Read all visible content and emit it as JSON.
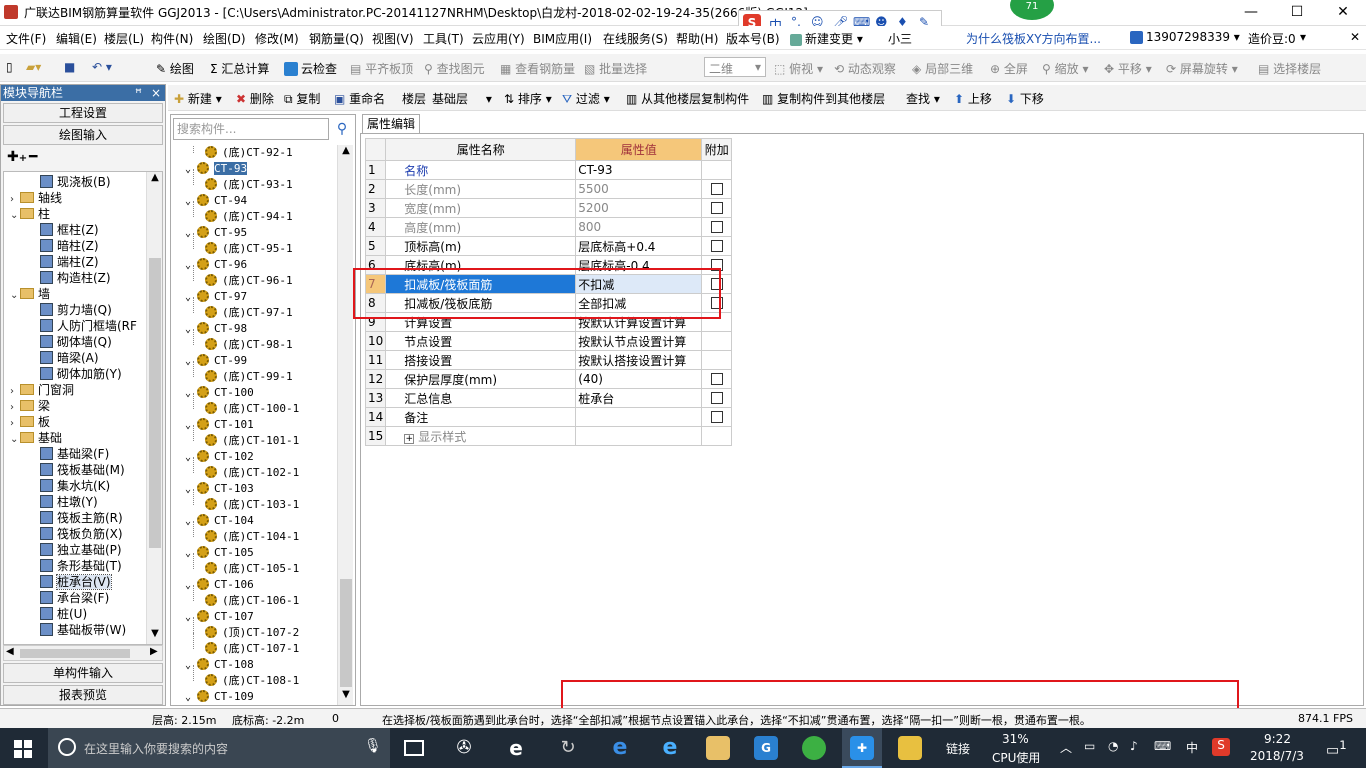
{
  "window": {
    "title": "广联达BIM钢筋算量软件 GGJ2013 - [C:\\Users\\Administrator.PC-20141127NRHM\\Desktop\\白龙村-2018-02-02-19-24-35(2666版).GGJ12]",
    "minimize": "—",
    "maximize": "☐",
    "close": "✕"
  },
  "overlay": {
    "badge_number": "71",
    "ime_text": "中",
    "hint_link": "为什么筏板XY方向布置...",
    "phone": "13907298339",
    "price_label": "造价豆:0",
    "new_change": "新建变更",
    "small_label": "小三",
    "version_label": "版本号(B)"
  },
  "menu": [
    "文件(F)",
    "编辑(E)",
    "楼层(L)",
    "构件(N)",
    "绘图(D)",
    "修改(M)",
    "钢筋量(Q)",
    "视图(V)",
    "工具(T)",
    "云应用(Y)",
    "BIM应用(I)",
    "在线服务(S)",
    "帮助(H)"
  ],
  "toolbar1": {
    "draw": "绘图",
    "sum": "汇总计算",
    "cloud_check": "云检查",
    "flat_top": "平齐板顶",
    "find_elem": "查找图元",
    "view_rebar": "查看钢筋量",
    "batch_select": "批量选择",
    "view_mode": "二维",
    "top_view": "俯视",
    "dyn_view": "动态观察",
    "local_3d": "局部三维",
    "fullscreen": "全屏",
    "zoom": "缩放",
    "pan": "平移",
    "rotate": "屏幕旋转",
    "select_floor": "选择楼层"
  },
  "toolbar2": {
    "new": "新建",
    "delete": "删除",
    "copy": "复制",
    "rename": "重命名",
    "floor_label": "楼层",
    "floor_value": "基础层",
    "sort": "排序",
    "filter": "过滤",
    "copy_from": "从其他楼层复制构件",
    "copy_to": "复制构件到其他楼层",
    "find": "查找",
    "move_up": "上移",
    "move_down": "下移"
  },
  "nav": {
    "header": "模块导航栏",
    "pin": "ꟸ",
    "close": "×",
    "project_settings": "工程设置",
    "drawing_input": "绘图输入",
    "single_input": "单构件输入",
    "report_preview": "报表预览",
    "tree": [
      {
        "label": "现浇板(B)",
        "level": 2,
        "type": "comp"
      },
      {
        "label": "轴线",
        "level": 0,
        "type": "folder",
        "exp": "›"
      },
      {
        "label": "柱",
        "level": 0,
        "type": "folder",
        "exp": "⌄"
      },
      {
        "label": "框柱(Z)",
        "level": 2,
        "type": "comp"
      },
      {
        "label": "暗柱(Z)",
        "level": 2,
        "type": "comp"
      },
      {
        "label": "端柱(Z)",
        "level": 2,
        "type": "comp"
      },
      {
        "label": "构造柱(Z)",
        "level": 2,
        "type": "comp"
      },
      {
        "label": "墙",
        "level": 0,
        "type": "folder",
        "exp": "⌄"
      },
      {
        "label": "剪力墙(Q)",
        "level": 2,
        "type": "comp"
      },
      {
        "label": "人防门框墙(RF",
        "level": 2,
        "type": "comp"
      },
      {
        "label": "砌体墙(Q)",
        "level": 2,
        "type": "comp"
      },
      {
        "label": "暗梁(A)",
        "level": 2,
        "type": "comp"
      },
      {
        "label": "砌体加筋(Y)",
        "level": 2,
        "type": "comp"
      },
      {
        "label": "门窗洞",
        "level": 0,
        "type": "folder",
        "exp": "›"
      },
      {
        "label": "梁",
        "level": 0,
        "type": "folder",
        "exp": "›"
      },
      {
        "label": "板",
        "level": 0,
        "type": "folder",
        "exp": "›"
      },
      {
        "label": "基础",
        "level": 0,
        "type": "folder",
        "exp": "⌄"
      },
      {
        "label": "基础梁(F)",
        "level": 2,
        "type": "comp"
      },
      {
        "label": "筏板基础(M)",
        "level": 2,
        "type": "comp"
      },
      {
        "label": "集水坑(K)",
        "level": 2,
        "type": "comp"
      },
      {
        "label": "柱墩(Y)",
        "level": 2,
        "type": "comp"
      },
      {
        "label": "筏板主筋(R)",
        "level": 2,
        "type": "comp"
      },
      {
        "label": "筏板负筋(X)",
        "level": 2,
        "type": "comp"
      },
      {
        "label": "独立基础(P)",
        "level": 2,
        "type": "comp"
      },
      {
        "label": "条形基础(T)",
        "level": 2,
        "type": "comp"
      },
      {
        "label": "桩承台(V)",
        "level": 2,
        "type": "comp",
        "selected": true
      },
      {
        "label": "承台梁(F)",
        "level": 2,
        "type": "comp"
      },
      {
        "label": "桩(U)",
        "level": 2,
        "type": "comp"
      },
      {
        "label": "基础板带(W)",
        "level": 2,
        "type": "comp"
      }
    ]
  },
  "components": {
    "search_placeholder": "搜索构件...",
    "items": [
      {
        "label": "(底)CT-92-1",
        "child": true
      },
      {
        "label": "CT-93",
        "child": false,
        "selected": true
      },
      {
        "label": "(底)CT-93-1",
        "child": true
      },
      {
        "label": "CT-94",
        "child": false
      },
      {
        "label": "(底)CT-94-1",
        "child": true
      },
      {
        "label": "CT-95",
        "child": false
      },
      {
        "label": "(底)CT-95-1",
        "child": true
      },
      {
        "label": "CT-96",
        "child": false
      },
      {
        "label": "(底)CT-96-1",
        "child": true
      },
      {
        "label": "CT-97",
        "child": false
      },
      {
        "label": "(底)CT-97-1",
        "child": true
      },
      {
        "label": "CT-98",
        "child": false
      },
      {
        "label": "(底)CT-98-1",
        "child": true
      },
      {
        "label": "CT-99",
        "child": false
      },
      {
        "label": "(底)CT-99-1",
        "child": true
      },
      {
        "label": "CT-100",
        "child": false
      },
      {
        "label": "(底)CT-100-1",
        "child": true
      },
      {
        "label": "CT-101",
        "child": false
      },
      {
        "label": "(底)CT-101-1",
        "child": true
      },
      {
        "label": "CT-102",
        "child": false
      },
      {
        "label": "(底)CT-102-1",
        "child": true
      },
      {
        "label": "CT-103",
        "child": false
      },
      {
        "label": "(底)CT-103-1",
        "child": true
      },
      {
        "label": "CT-104",
        "child": false
      },
      {
        "label": "(底)CT-104-1",
        "child": true
      },
      {
        "label": "CT-105",
        "child": false
      },
      {
        "label": "(底)CT-105-1",
        "child": true
      },
      {
        "label": "CT-106",
        "child": false
      },
      {
        "label": "(底)CT-106-1",
        "child": true
      },
      {
        "label": "CT-107",
        "child": false
      },
      {
        "label": "(顶)CT-107-2",
        "child": true
      },
      {
        "label": "(底)CT-107-1",
        "child": true
      },
      {
        "label": "CT-108",
        "child": false
      },
      {
        "label": "(底)CT-108-1",
        "child": true
      },
      {
        "label": "CT-109",
        "child": false
      }
    ]
  },
  "properties": {
    "tab": "属性编辑",
    "col_name": "属性名称",
    "col_value": "属性值",
    "col_extra": "附加",
    "rows": [
      {
        "n": "1",
        "name": "名称",
        "value": "CT-93",
        "cb": false,
        "style": "blue"
      },
      {
        "n": "2",
        "name": "长度(mm)",
        "value": "5500",
        "cb": true,
        "style": "gray"
      },
      {
        "n": "3",
        "name": "宽度(mm)",
        "value": "5200",
        "cb": true,
        "style": "gray"
      },
      {
        "n": "4",
        "name": "高度(mm)",
        "value": "800",
        "cb": true,
        "style": "gray"
      },
      {
        "n": "5",
        "name": "顶标高(m)",
        "value": "层底标高+0.4",
        "cb": true,
        "style": ""
      },
      {
        "n": "6",
        "name": "底标高(m)",
        "value": "层底标高-0.4",
        "cb": true,
        "style": ""
      },
      {
        "n": "7",
        "name": "扣减板/筏板面筋",
        "value": "不扣减",
        "cb": true,
        "style": "",
        "hl": true
      },
      {
        "n": "8",
        "name": "扣减板/筏板底筋",
        "value": "全部扣减",
        "cb": true,
        "style": ""
      },
      {
        "n": "9",
        "name": "计算设置",
        "value": "按默认计算设置计算",
        "cb": false,
        "style": ""
      },
      {
        "n": "10",
        "name": "节点设置",
        "value": "按默认节点设置计算",
        "cb": false,
        "style": ""
      },
      {
        "n": "11",
        "name": "搭接设置",
        "value": "按默认搭接设置计算",
        "cb": false,
        "style": ""
      },
      {
        "n": "12",
        "name": "保护层厚度(mm)",
        "value": "(40)",
        "cb": true,
        "style": ""
      },
      {
        "n": "13",
        "name": "汇总信息",
        "value": "桩承台",
        "cb": true,
        "style": ""
      },
      {
        "n": "14",
        "name": "备注",
        "value": "",
        "cb": true,
        "style": ""
      },
      {
        "n": "15",
        "name": "显示样式",
        "value": "",
        "cb": false,
        "style": "gray",
        "expand": "+"
      }
    ]
  },
  "status": {
    "floor_height": "层高: 2.15m",
    "floor_bottom": "底标高: -2.2m",
    "zero": "0",
    "hint": "在选择板/筏板面筋遇到此承台时，选择“全部扣减”根据节点设置锚入此承台，选择“不扣减”贯通布置，选择“隔一扣一”则断一根，贯通布置一根。",
    "fps": "874.1 FPS"
  },
  "taskbar": {
    "search_placeholder": "在这里输入你要搜索的内容",
    "link": "链接",
    "cpu_percent": "31%",
    "cpu_label": "CPU使用",
    "ime": "中",
    "time": "9:22",
    "date": "2018/7/3",
    "notif": "1"
  }
}
